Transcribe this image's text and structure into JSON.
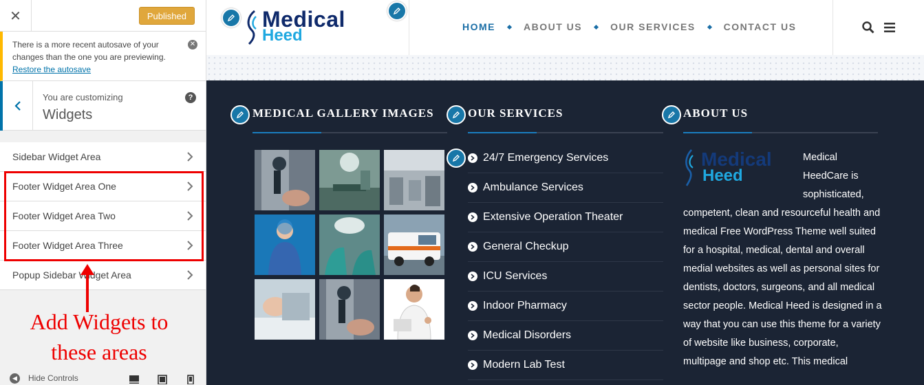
{
  "customizer": {
    "close_glyph": "✕",
    "published_label": "Published",
    "autosave": {
      "message": "There is a more recent autosave of your changes than the one you are previewing.",
      "restore_link": "Restore the autosave"
    },
    "panel": {
      "label": "You are customizing",
      "title": "Widgets"
    },
    "widget_areas": [
      "Sidebar Widget Area",
      "Footer Widget Area One",
      "Footer Widget Area Two",
      "Footer Widget Area Three",
      "Popup Sidebar Widget Area"
    ],
    "annotation": "Add Widgets to these areas",
    "annotation_color": "#ee0000",
    "hide_controls_label": "Hide Controls"
  },
  "site": {
    "logo_line1": "Medical",
    "logo_line2": "Heed",
    "nav": [
      "HOME",
      "ABOUT US",
      "OUR SERVICES",
      "CONTACT US"
    ],
    "accent_color": "#1a6ea6",
    "footer": {
      "gallery_title": "MEDICAL GALLERY IMAGES",
      "services_title": "OUR SERVICES",
      "about_title": "ABOUT US",
      "services": [
        "24/7 Emergency Services",
        "Ambulance Services",
        "Extensive Operation Theater",
        "General Checkup",
        "ICU Services",
        "Indoor Pharmacy",
        "Medical Disorders",
        "Modern Lab Test"
      ],
      "about_logo_line1": "Medical",
      "about_logo_line2": "Heed",
      "about_text": "Medical HeedCare is sophisticated, competent, clean and resourceful health and medical Free WordPress Theme well suited for a hospital, medical, dental and overall medial websites as well as personal sites for dentists, doctors, surgeons, and all medical sector people. Medical Heed is designed in a way that you can use this theme for a variety of website like business, corporate, multipage and shop etc. This medical"
    }
  }
}
